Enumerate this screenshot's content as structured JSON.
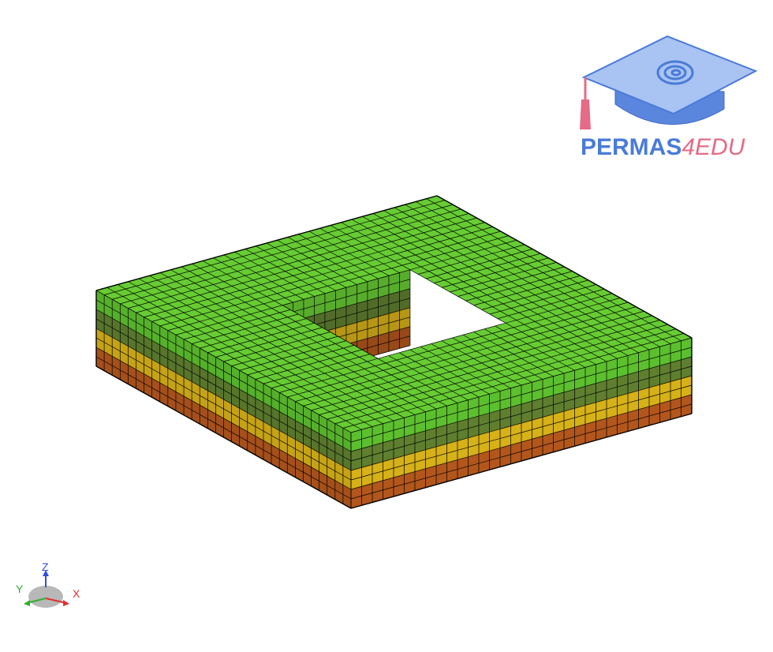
{
  "logo": {
    "brand_part1": "PERMAS",
    "brand_part2": "4EDU",
    "colors": {
      "blue": "#4a7bd8",
      "pink": "#e56b86",
      "cap_light": "#a9c3f2",
      "cap_dark": "#5b86de"
    }
  },
  "model": {
    "layers": [
      {
        "name": "top",
        "color": "#66cc33",
        "side_color": "#5cbf2e"
      },
      {
        "name": "layer2",
        "color": "#5f7f2f"
      },
      {
        "name": "layer3",
        "color": "#d6b117"
      },
      {
        "name": "layer4",
        "color": "#b3561c"
      }
    ],
    "edge_color": "#000000"
  },
  "triad": {
    "z_label": "Z",
    "y_label": "Y",
    "x_label": "X",
    "colors": {
      "x": "#e03030",
      "y": "#30b030",
      "z": "#3050e0"
    }
  }
}
